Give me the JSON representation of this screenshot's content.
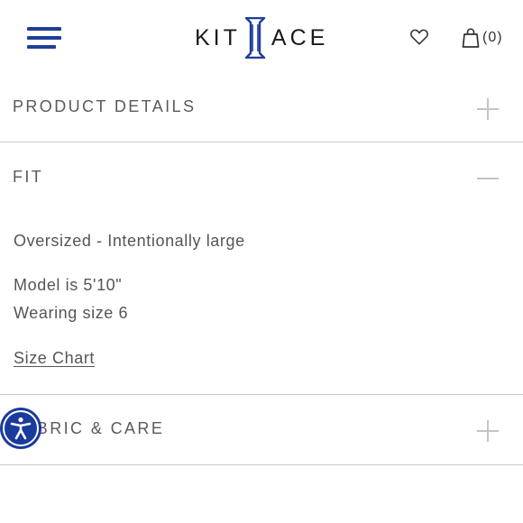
{
  "header": {
    "logo_left": "KIT",
    "logo_right": "ACE",
    "cart_count": "(0)"
  },
  "sections": [
    {
      "title": "PRODUCT DETAILS",
      "state": "collapsed"
    },
    {
      "title": "FIT",
      "state": "expanded",
      "content": {
        "fit_line": "Oversized - Intentionally large",
        "model_line": "Model is 5'10\"",
        "size_line": "Wearing size 6",
        "link": "Size Chart"
      }
    },
    {
      "title": "FABRIC & CARE",
      "state": "collapsed"
    }
  ],
  "colors": {
    "brand_blue": "#1d3f9b",
    "toggle_gray": "#c4c4c4",
    "divider": "#c9c9c9"
  },
  "icons": [
    "menu-icon",
    "heart-icon",
    "shopping-bag-icon",
    "plus-icon",
    "minus-icon",
    "accessibility-icon"
  ]
}
